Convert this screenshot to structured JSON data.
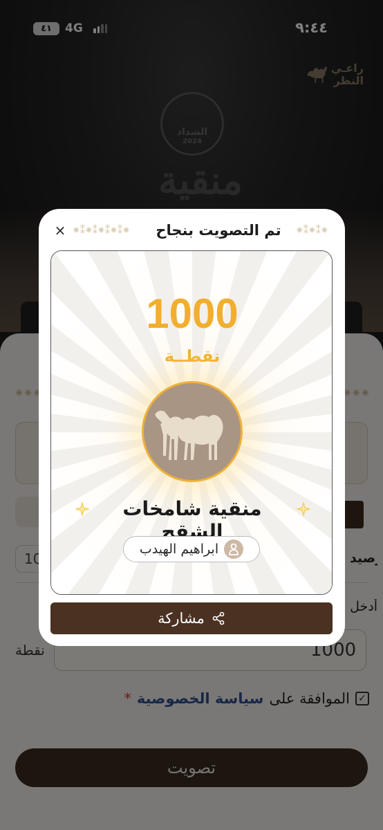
{
  "status_bar": {
    "time": "٩:٤٤",
    "network": "4G",
    "battery": "٤١"
  },
  "background": {
    "sponsor_line1": "راعـي",
    "sponsor_line2": "النظر",
    "badge_text": "الشداد",
    "badge_year": "2024",
    "calligraphy": "منقية"
  },
  "form": {
    "ornament": "⁕⁕⁕",
    "count_value": "10",
    "row1_label": "رصيد",
    "row2_label": "أدخل",
    "points_input_value": "1000",
    "points_unit": "نقطة",
    "consent_text": "الموافقة على",
    "consent_link": "سياسة الخصوصية",
    "consent_required": "*",
    "consent_checked": true,
    "vote_button": "تصويت"
  },
  "modal": {
    "title": "تم التصويت بنجاح",
    "close_label": "×",
    "ornament_left": "⁕⁑⁕⁑⁕⁑⁕⁑⁕",
    "ornament_right": "⁕⁑⁕⁑⁕",
    "points_value": "1000",
    "points_label": "نقطــة",
    "entry_name": "منقية شامخات الشقح",
    "owner_name": "ابراهيم الهيدب",
    "share_label": "مشاركة",
    "colors": {
      "accent_gold": "#f2ae2e",
      "brown_dark": "#4a3121",
      "camel_bg": "#a89584"
    }
  }
}
